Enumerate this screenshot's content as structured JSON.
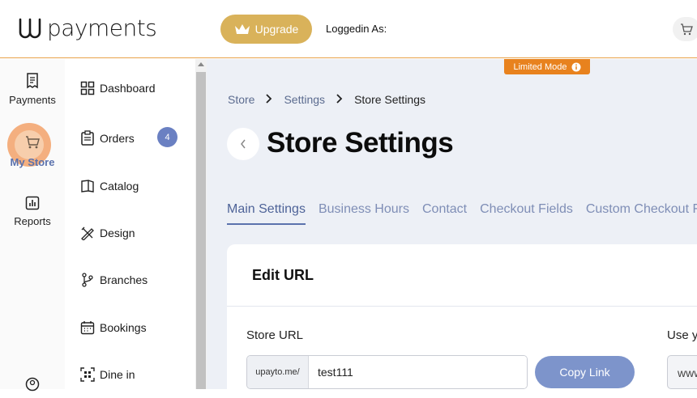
{
  "header": {
    "logo_text": "payments",
    "upgrade_label": "Upgrade",
    "logged_in_label": "Loggedin As:"
  },
  "rail": {
    "items": [
      {
        "label": "Payments",
        "icon": "receipt-icon"
      },
      {
        "label": "My Store",
        "icon": "cart-icon",
        "active": true
      },
      {
        "label": "Reports",
        "icon": "chart-icon"
      }
    ]
  },
  "sidebar": {
    "items": [
      {
        "label": "Dashboard",
        "icon": "grid-icon"
      },
      {
        "label": "Orders",
        "icon": "clipboard-icon",
        "badge": "4"
      },
      {
        "label": "Catalog",
        "icon": "book-icon"
      },
      {
        "label": "Design",
        "icon": "pencil-ruler-icon"
      },
      {
        "label": "Branches",
        "icon": "branch-icon"
      },
      {
        "label": "Bookings",
        "icon": "calendar-icon"
      },
      {
        "label": "Dine in",
        "icon": "qr-icon"
      }
    ]
  },
  "status": {
    "mode_label": "Limited Mode"
  },
  "breadcrumb": [
    "Store",
    "Settings",
    "Store Settings"
  ],
  "page": {
    "title": "Store Settings",
    "tabs": [
      "Main Settings",
      "Business Hours",
      "Contact",
      "Checkout Fields",
      "Custom Checkout Fie"
    ],
    "active_tab": "Main Settings"
  },
  "edit_url": {
    "heading": "Edit URL",
    "store_url_label": "Store URL",
    "prefix": "upayto.me/",
    "value": "test111",
    "copy_label": "Copy Link",
    "use_label": "Use y",
    "www_value": "www"
  },
  "colors": {
    "accent_orange": "#e8821e",
    "upgrade_gold": "#d9b25a",
    "primary_blue": "#7d94cb",
    "active_store": "#5b72ad"
  }
}
